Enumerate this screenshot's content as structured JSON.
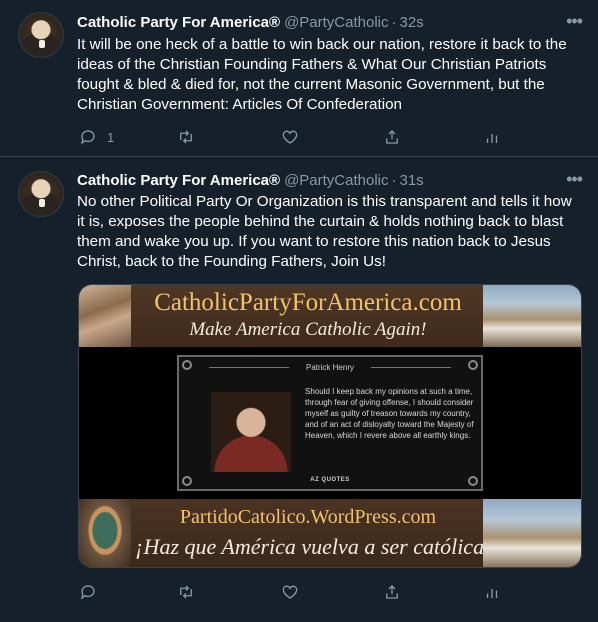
{
  "tweets": [
    {
      "name": "Catholic Party For America®",
      "handle": "@PartyCatholic",
      "time": "32s",
      "text": "It will be one heck of a battle to win back our nation, restore it back to the ideas of the Christian Founding Fathers & What Our Christian Patriots fought & bled & died for, not the current Masonic Government, but the Christian Government: Articles Of Confederation",
      "reply_count": "1",
      "more_icon": "more-horizontal-icon"
    },
    {
      "name": "Catholic Party For America®",
      "handle": "@PartyCatholic",
      "time": "31s",
      "text": "No other Political Party Or Organization is this transparent and tells it how it is, exposes the people behind the curtain & holds nothing back to blast them and wake you up.  If you want to restore this nation back to Jesus Christ, back to the Founding Fathers, Join Us!",
      "reply_count": "",
      "more_icon": "more-horizontal-icon"
    }
  ],
  "media": {
    "top_title": "CatholicPartyForAmerica.com",
    "top_subtitle": "Make America Catholic Again!",
    "quote_author": "Patrick Henry",
    "quote_text": "Should I keep back my opinions at such a time, through fear of giving offense, I should consider myself as guilty of treason towards my country, and of an act of disloyalty toward the Majesty of Heaven, which I revere above all earthly kings.",
    "quote_source": "AZ QUOTES",
    "bottom_title": "PartidoCatolico.WordPress.com",
    "bottom_subtitle": "¡Haz que América vuelva a ser católica!"
  },
  "colors": {
    "background": "#15202b",
    "secondary_text": "#8899a6",
    "divider": "#38444d",
    "banner_gold": "#f2c36b"
  }
}
